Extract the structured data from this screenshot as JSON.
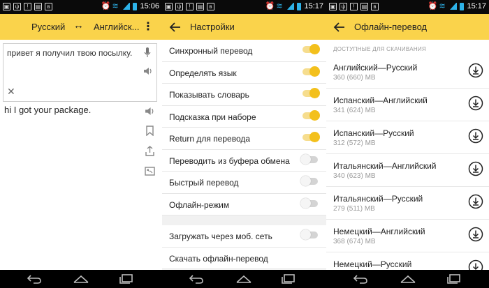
{
  "screens": {
    "translate": {
      "status_time": "15:06",
      "from_lang": "Русский",
      "swap_symbol": "↔",
      "to_lang": "Английск...",
      "input_text": "привет я получил твою посылку.",
      "result_text": "hi I got your package."
    },
    "settings": {
      "status_time": "15:17",
      "title": "Настройки",
      "rows": [
        {
          "label": "Синхронный перевод",
          "on": true
        },
        {
          "label": "Определять язык",
          "on": true
        },
        {
          "label": "Показывать словарь",
          "on": true
        },
        {
          "label": "Подсказка при наборе",
          "on": true
        },
        {
          "label": "Return для перевода",
          "on": true
        },
        {
          "label": "Переводить из буфера обмена",
          "on": false
        },
        {
          "label": "Быстрый перевод",
          "on": false
        },
        {
          "label": "Офлайн-режим",
          "on": false
        }
      ],
      "rows2": [
        {
          "label": "Загружать через моб. сеть",
          "on": false
        },
        {
          "label": "Скачать офлайн-перевод",
          "on": null
        }
      ]
    },
    "offline": {
      "status_time": "15:17",
      "title": "Офлайн-перевод",
      "section": "ДОСТУПНЫЕ ДЛЯ СКАЧИВАНИЯ",
      "packs": [
        {
          "name": "Английский—Русский",
          "size": "360 (660) MB"
        },
        {
          "name": "Испанский—Английский",
          "size": "341 (624) MB"
        },
        {
          "name": "Испанский—Русский",
          "size": "312 (572) MB"
        },
        {
          "name": "Итальянский—Английский",
          "size": "340 (623) MB"
        },
        {
          "name": "Итальянский—Русский",
          "size": "279 (511) MB"
        },
        {
          "name": "Немецкий—Английский",
          "size": "368 (674) MB"
        },
        {
          "name": "Немецкий—Русский",
          "size": ""
        }
      ]
    }
  },
  "colors": {
    "accent": "#fad34b",
    "toggle_on": "#f3c01c",
    "status_icons": "#2db2e8"
  },
  "icons": [
    "menu-more-icon",
    "mic-icon",
    "speaker-icon",
    "close-icon",
    "bookmark-icon",
    "share-icon",
    "fullscreen-icon",
    "back-arrow-icon",
    "download-icon",
    "nav-back-icon",
    "nav-home-icon",
    "nav-recents-icon"
  ]
}
